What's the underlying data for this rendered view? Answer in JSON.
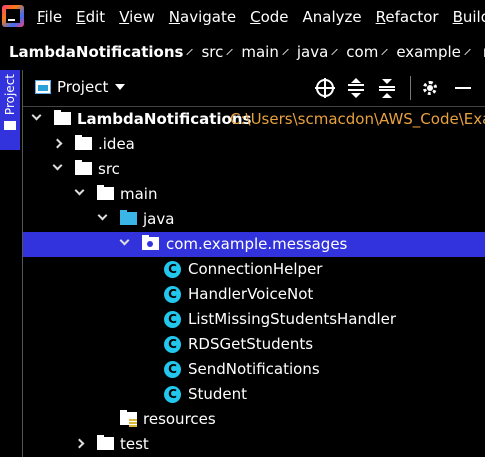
{
  "menubar": {
    "items": [
      {
        "mnemonic": "F",
        "rest": "ile"
      },
      {
        "mnemonic": "E",
        "rest": "dit"
      },
      {
        "mnemonic": "V",
        "rest": "iew"
      },
      {
        "mnemonic": "N",
        "rest": "avigate"
      },
      {
        "mnemonic": "C",
        "rest": "ode"
      },
      {
        "mnemonic": "",
        "rest": "Analyze"
      },
      {
        "mnemonic": "R",
        "rest": "efactor"
      },
      {
        "mnemonic": "B",
        "rest": "uild"
      }
    ]
  },
  "breadcrumb": [
    "LambdaNotifications",
    "src",
    "main",
    "java",
    "com",
    "example",
    "me"
  ],
  "side_tab": {
    "label": "Project"
  },
  "panel": {
    "title": "Project"
  },
  "tree": {
    "root": {
      "label": "LambdaNotifications",
      "path": "C:\\Users\\scmacdon\\AWS_Code\\Exar"
    },
    "idea": ".idea",
    "src": "src",
    "main": "main",
    "java": "java",
    "package": "com.example.messages",
    "class_badge": "C",
    "classes": [
      "ConnectionHelper",
      "HandlerVoiceNot",
      "ListMissingStudentsHandler",
      "RDSGetStudents",
      "SendNotifications",
      "Student"
    ],
    "resources": "resources",
    "test": "test"
  },
  "colors": {
    "selection": "#3333dd",
    "path_text": "#e7a13e",
    "class_icon": "#22c7ee",
    "source_folder": "#3bb4e8"
  }
}
